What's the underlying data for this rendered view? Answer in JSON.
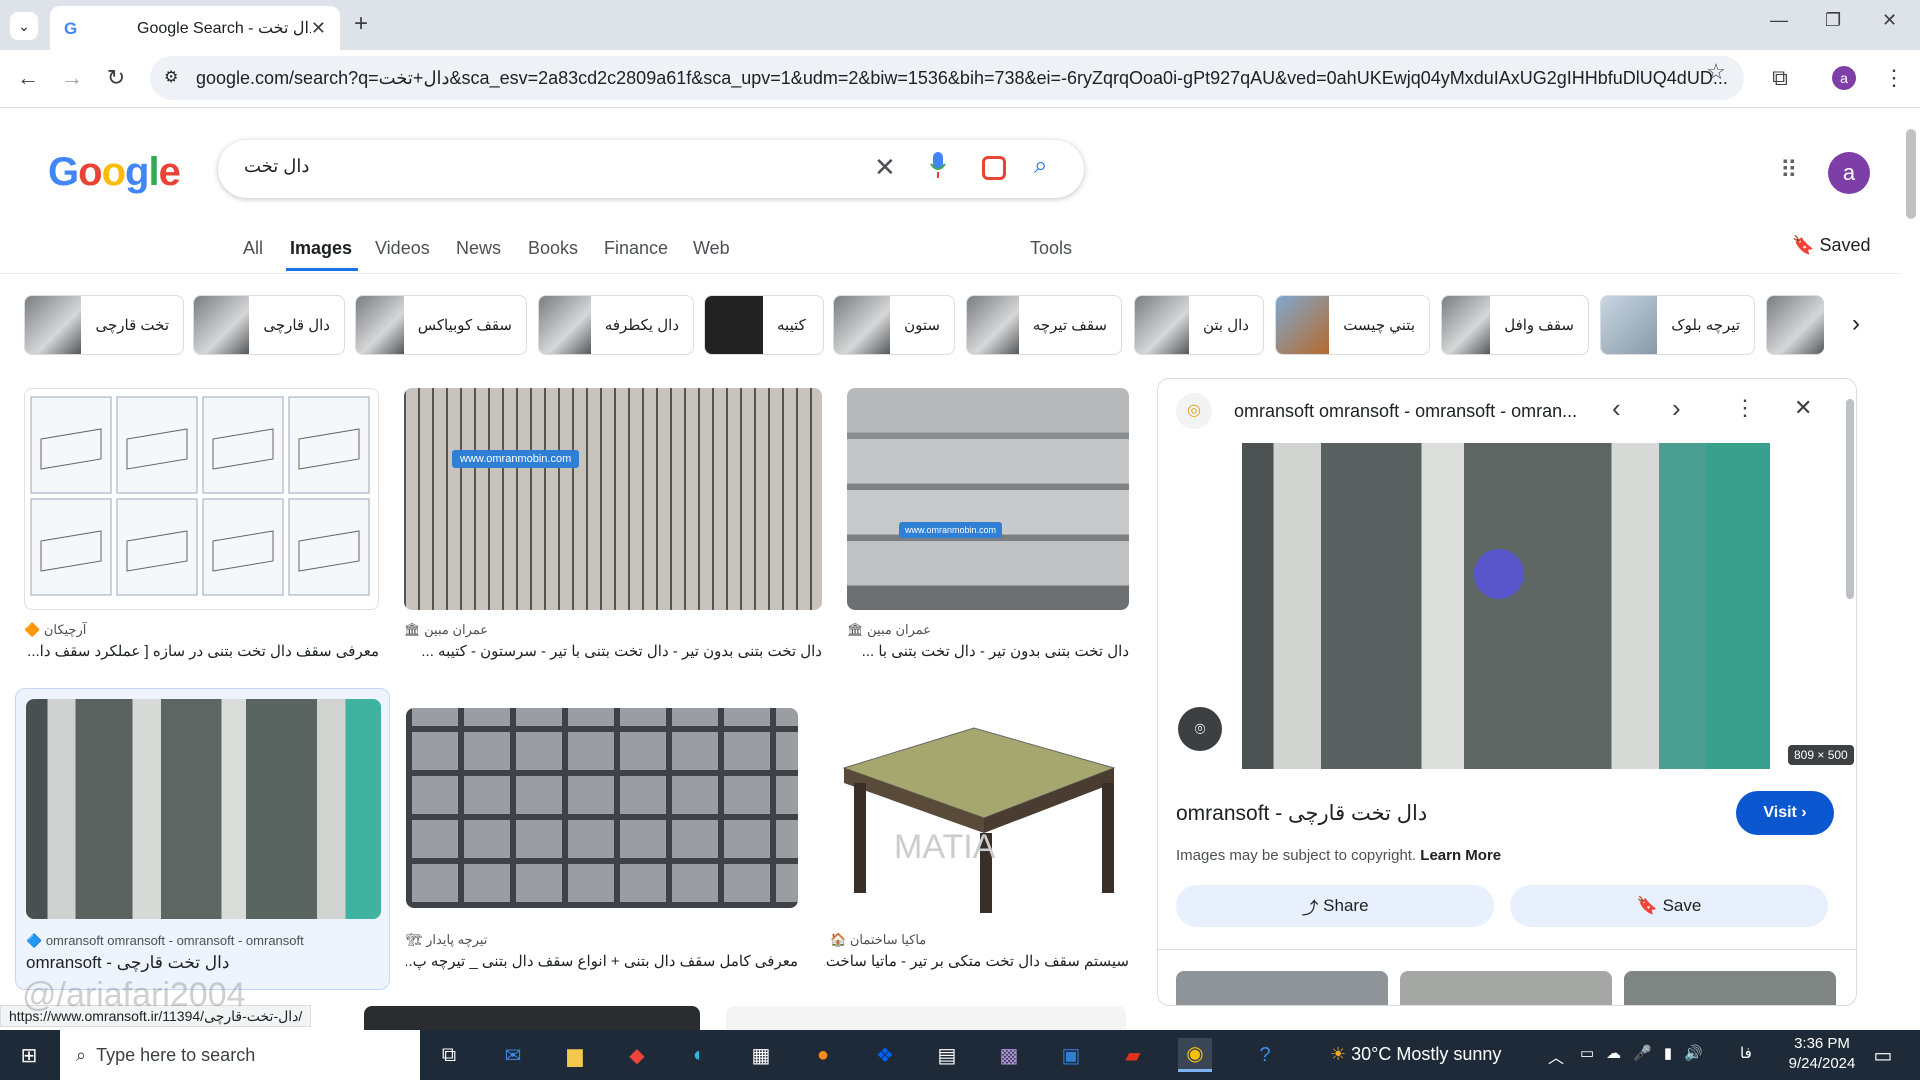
{
  "browser": {
    "tab_title": "Google Search - دال تخت",
    "url": "google.com/search?q=دال+تخت&sca_esv=2a83cd2c2809a61f&sca_upv=1&udm=2&biw=1536&bih=738&ei=-6ryZqrqOoa0i-gPt927qAU&ved=0ahUKEwjq04yMxduIAxUG2gIHHbfuDlUQ4dUD...",
    "profile_initial": "a"
  },
  "search": {
    "query": "دال تخت",
    "logo": "Google"
  },
  "nav": {
    "all": "All",
    "images": "Images",
    "videos": "Videos",
    "news": "News",
    "books": "Books",
    "finance": "Finance",
    "web": "Web",
    "tools": "Tools",
    "saved": "Saved"
  },
  "chips": [
    "تخت قارچی",
    "دال قارچی",
    "سقف کوبیاکس",
    "دال یکطرفه",
    "کتیبه",
    "ستون",
    "سقف تیرچه",
    "دال بتن",
    "بتني چیست",
    "سقف وافل",
    "تیرچه بلوک"
  ],
  "results": [
    {
      "source": "آرچیکان",
      "caption": "معرفی سقف دال تخت بتنی در سازه [ عملکرد سقف دا..."
    },
    {
      "source": "عمران مبین",
      "caption": "دال تخت بتنی بدون تیر - دال تخت بتنی با تیر - سرستون - کتیبه ...",
      "watermark": "www.omranmobin.com"
    },
    {
      "source": "عمران مبین",
      "caption": "دال تخت بتنی بدون تیر - دال تخت بتنی با ...",
      "watermark": "www.omranmobin.com"
    },
    {
      "source": "omransoft omransoft - omransoft - omransoft",
      "caption": "omransoft - دال تخت قارچی"
    },
    {
      "source": "تیرچه پایدار",
      "caption": "معرفی کامل سقف دال بتنی + انواع سقف دال بتنی _ تیرچه پ..."
    },
    {
      "source": "ماکیا ساختمان",
      "caption": "سیستم سقف دال تخت متکی بر تیر - ماتیا ساخت...",
      "watermark": "MATIA"
    }
  ],
  "panel": {
    "source": "omransoft omransoft - omransoft - omran...",
    "size": "809 × 500",
    "title": "omransoft - دال تخت قارچی",
    "visit": "Visit",
    "copyright": "Images may be subject to copyright.",
    "learn_more": "Learn More",
    "share": "Share",
    "save": "Save"
  },
  "status_url": "https://www.omransoft.ir/11394/دال-تخت-قارچی/",
  "overlay_watermark": "@/ariafari2004",
  "taskbar": {
    "search_placeholder": "Type here to search",
    "weather": "30°C  Mostly sunny",
    "lang": "فا",
    "time": "3:36 PM",
    "date": "9/24/2024"
  },
  "colors": {
    "accent": "#1a73e8",
    "visit": "#0b57d0",
    "chip_border": "#dadce0"
  }
}
